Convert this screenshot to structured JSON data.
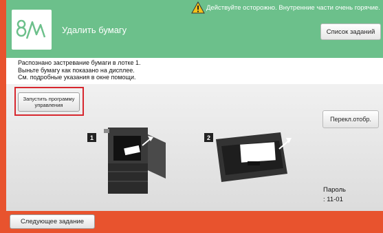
{
  "header": {
    "title": "Удалить бумагу",
    "warning": "Действуйте осторожно. Внутренние части очень горячие.",
    "jobs_button": "Список заданий"
  },
  "message": {
    "lines": [
      "Распознано застревание бумаги в лотке 1.",
      "Выньте бумагу как показано на дисплее.",
      "См. подробные указания в окне помощи."
    ]
  },
  "guide_button": {
    "line1": "Запустить программу",
    "line2": "управления"
  },
  "switch_button": "Перекл.отобр.",
  "steps": [
    "1",
    "2"
  ],
  "password": {
    "label": "Пароль",
    "value": ": 11-01"
  },
  "footer": {
    "next_job": "Следующее задание"
  },
  "colors": {
    "header": "#6cc08b",
    "frame": "#e8532e",
    "highlight": "#d7262d",
    "warning": "#f4c21a"
  },
  "icons": {
    "logo": "paper-jam-logo",
    "warning": "warning-triangle-icon"
  }
}
